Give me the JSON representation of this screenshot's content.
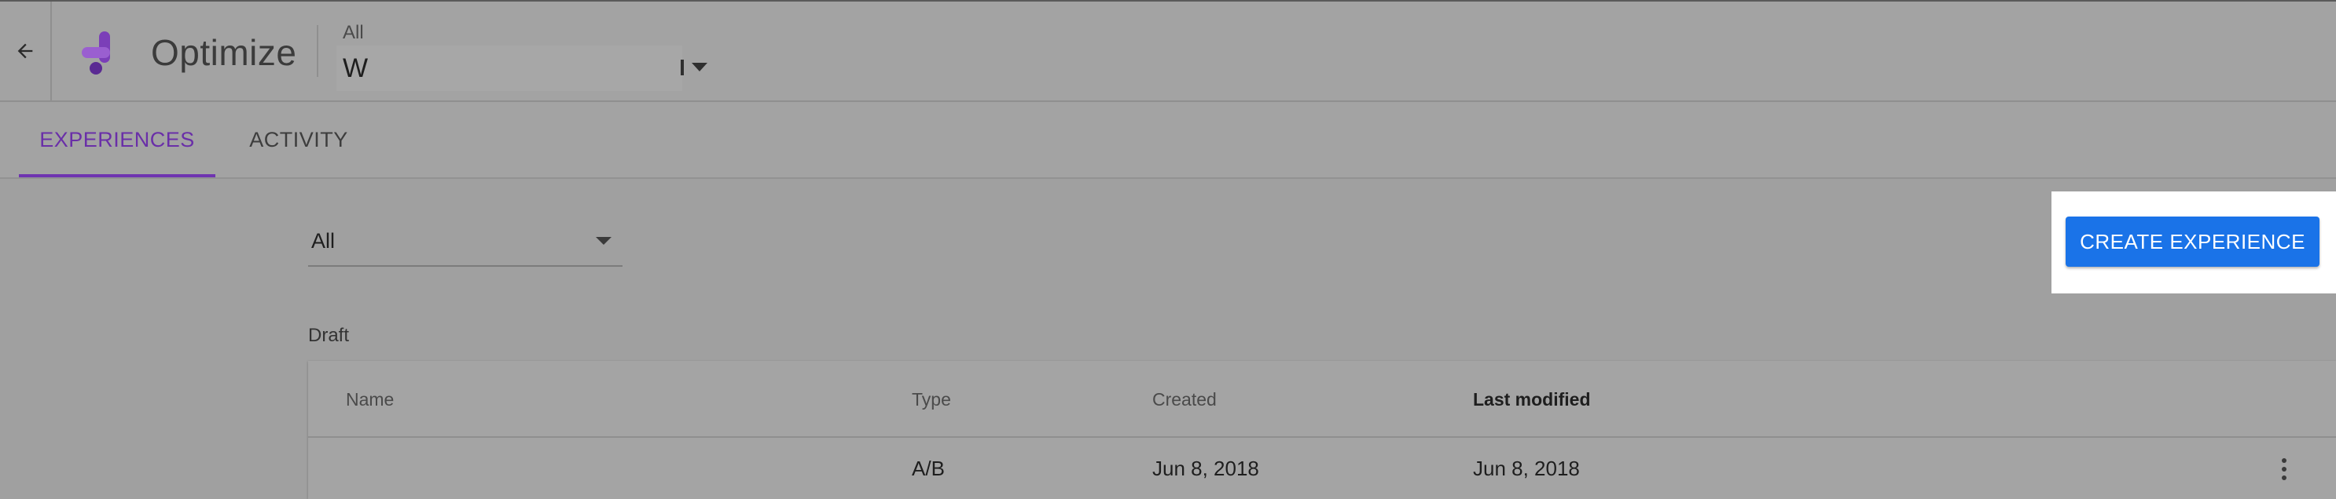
{
  "header": {
    "app_title": "Optimize",
    "account_label": "All",
    "account_name": "W",
    "back_icon": "arrow-back-icon",
    "logo_icon": "optimize-logo",
    "caret_icon": "caret-down-icon"
  },
  "tabs": [
    {
      "label": "EXPERIENCES",
      "active": true
    },
    {
      "label": "ACTIVITY",
      "active": false
    }
  ],
  "filter": {
    "value": "All",
    "caret_icon": "caret-down-icon"
  },
  "actions": {
    "create_label": "CREATE EXPERIENCE"
  },
  "draft": {
    "section_label": "Draft",
    "columns": [
      "Name",
      "Type",
      "Created",
      "Last modified"
    ],
    "rows": [
      {
        "name": "",
        "type": "A/B",
        "created": "Jun 8, 2018",
        "last_modified": "Jun 8, 2018"
      }
    ],
    "more_icon": "more-vert-icon"
  },
  "colors": {
    "accent_purple": "#6f35b0",
    "primary_blue": "#1a73e8",
    "highlight": "#ffffff"
  }
}
